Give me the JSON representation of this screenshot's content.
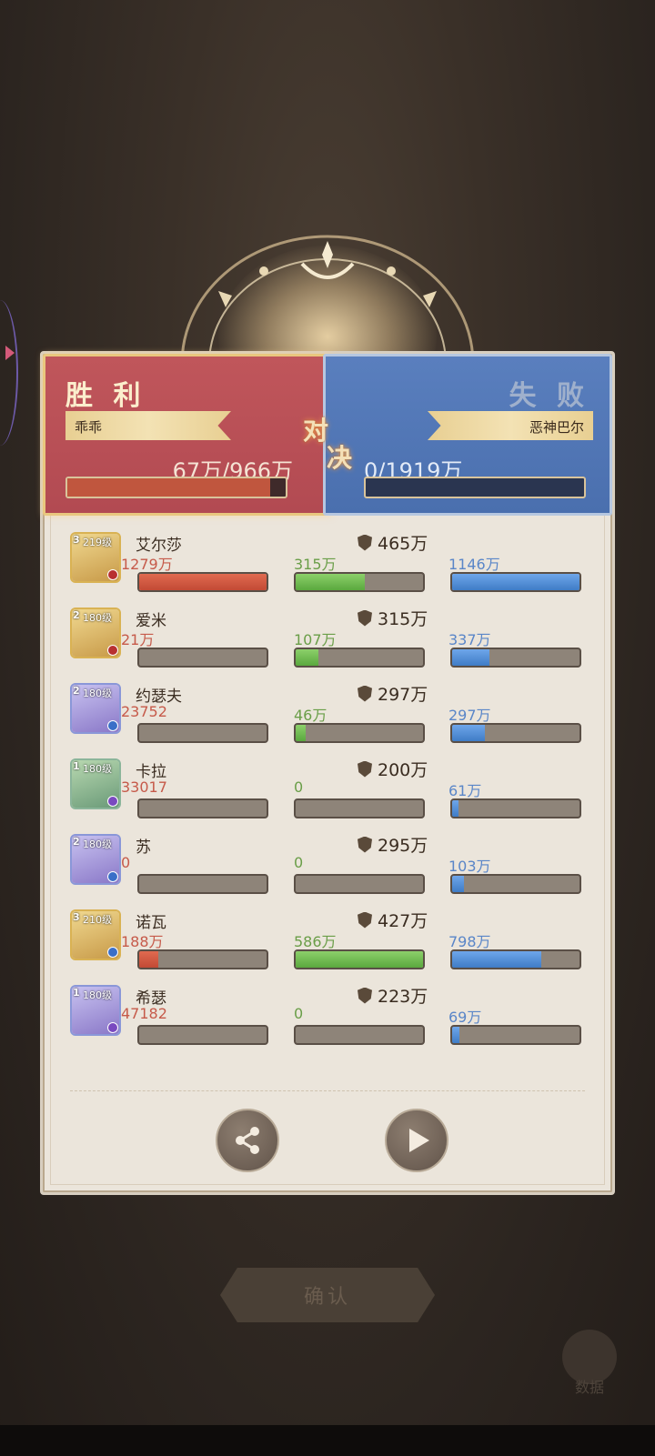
{
  "battle": {
    "win": {
      "title": "胜 利",
      "player": "乖乖",
      "power": "67万/966万",
      "bar_fraction": 0.93
    },
    "lose": {
      "title": "失 败",
      "player": "恶神巴尔",
      "power": "0/1919万",
      "bar_fraction": 0
    },
    "vs_top": "对",
    "vs_bottom": "决"
  },
  "heroes": [
    {
      "name": "艾尔莎",
      "star": "3",
      "level": "219级",
      "power": "465万",
      "damage": "1279万",
      "heal": "315万",
      "taken": "1146万",
      "damage_fill": 1.0,
      "heal_fill": 0.54,
      "taken_fill": 1.0,
      "frame": "gold",
      "badge": "red"
    },
    {
      "name": "爱米",
      "star": "2",
      "level": "180级",
      "power": "315万",
      "damage": "21万",
      "heal": "107万",
      "taken": "337万",
      "damage_fill": 0.0,
      "heal_fill": 0.18,
      "taken_fill": 0.29,
      "frame": "gold",
      "badge": "red"
    },
    {
      "name": "约瑟夫",
      "star": "2",
      "level": "180级",
      "power": "297万",
      "damage": "23752",
      "heal": "46万",
      "taken": "297万",
      "damage_fill": 0.0,
      "heal_fill": 0.08,
      "taken_fill": 0.26,
      "frame": "blue",
      "badge": "blue"
    },
    {
      "name": "卡拉",
      "star": "1",
      "level": "180级",
      "power": "200万",
      "damage": "33017",
      "heal": "0",
      "taken": "61万",
      "damage_fill": 0.0,
      "heal_fill": 0.0,
      "taken_fill": 0.05,
      "frame": "green",
      "badge": "purple"
    },
    {
      "name": "苏",
      "star": "2",
      "level": "180级",
      "power": "295万",
      "damage": "0",
      "heal": "0",
      "taken": "103万",
      "damage_fill": 0.0,
      "heal_fill": 0.0,
      "taken_fill": 0.09,
      "frame": "blue",
      "badge": "blue"
    },
    {
      "name": "诺瓦",
      "star": "3",
      "level": "210级",
      "power": "427万",
      "damage": "188万",
      "heal": "586万",
      "taken": "798万",
      "damage_fill": 0.15,
      "heal_fill": 1.0,
      "taken_fill": 0.7,
      "frame": "gold",
      "badge": "blue"
    },
    {
      "name": "希瑟",
      "star": "1",
      "level": "180级",
      "power": "223万",
      "damage": "47182",
      "heal": "0",
      "taken": "69万",
      "damage_fill": 0.0,
      "heal_fill": 0.0,
      "taken_fill": 0.06,
      "frame": "blue",
      "badge": "purple"
    }
  ],
  "actions": {
    "share_icon": "share-icon",
    "play_icon": "play-icon"
  },
  "footer": {
    "confirm": "确认",
    "data": "数据"
  },
  "colors": {
    "win": "#b24a52",
    "lose": "#4a6fae",
    "damage": "#c65a4a",
    "heal": "#6a9e48",
    "taken": "#5a86c8"
  }
}
